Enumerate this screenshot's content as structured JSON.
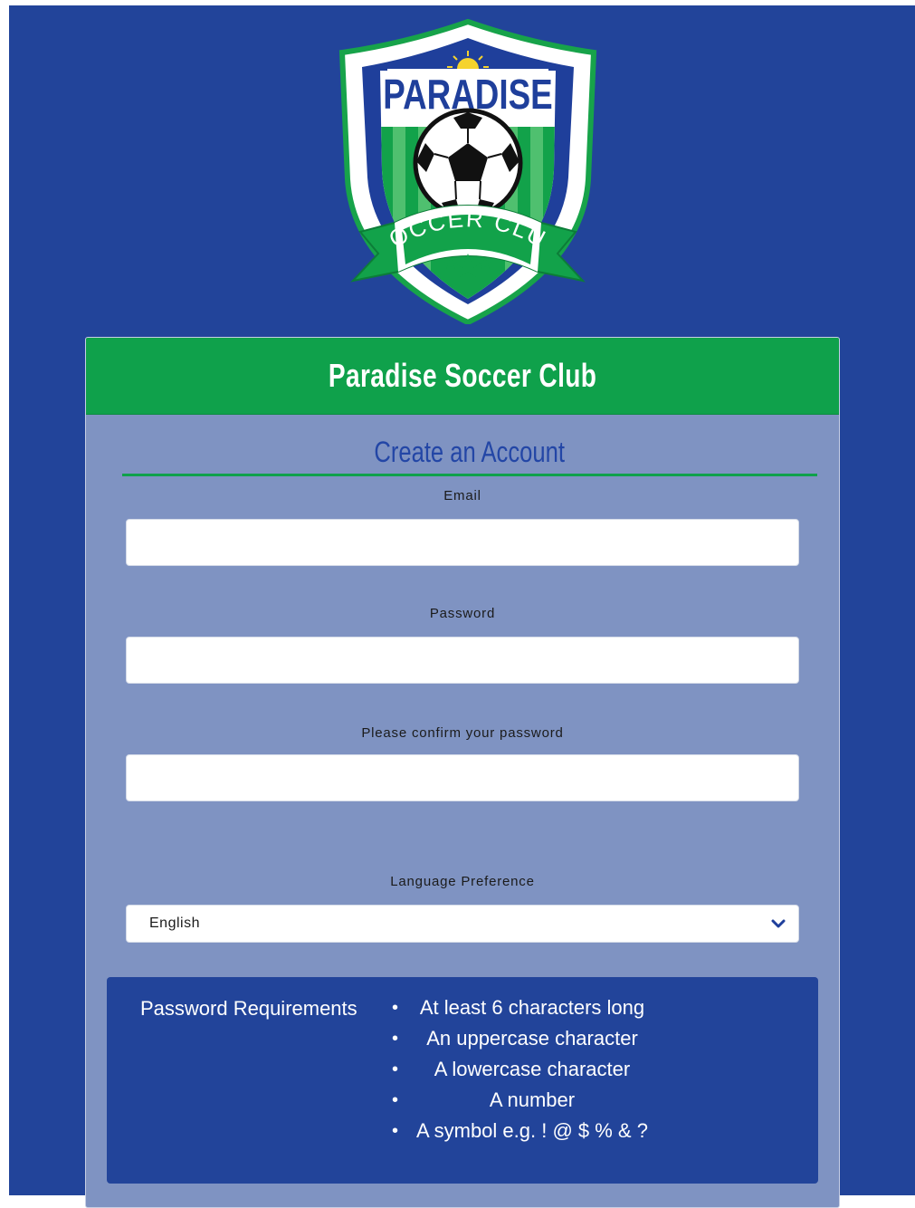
{
  "logo": {
    "top_text": "PARADISE",
    "bottom_text": "SOCCER CLUB",
    "colors": {
      "blue": "#1f3f9b",
      "green": "#12a24a",
      "yellow": "#f5d32d"
    }
  },
  "header": {
    "title": "Paradise Soccer Club"
  },
  "form": {
    "section_title": "Create an Account",
    "email_label": "Email",
    "email_value": "",
    "password_label": "Password",
    "password_value": "",
    "confirm_label": "Please confirm your password",
    "confirm_value": "",
    "language_label": "Language Preference",
    "language_value": "English"
  },
  "requirements": {
    "title": "Password Requirements",
    "items": [
      "At least 6 characters long",
      "An uppercase character",
      "A lowercase character",
      "A number",
      "A symbol e.g. ! @ $ % & ?"
    ]
  },
  "colors": {
    "page_background": "#22449a",
    "card_background": "#7f93c2",
    "header_green": "#0fa14b",
    "title_blue": "#2346a6"
  }
}
